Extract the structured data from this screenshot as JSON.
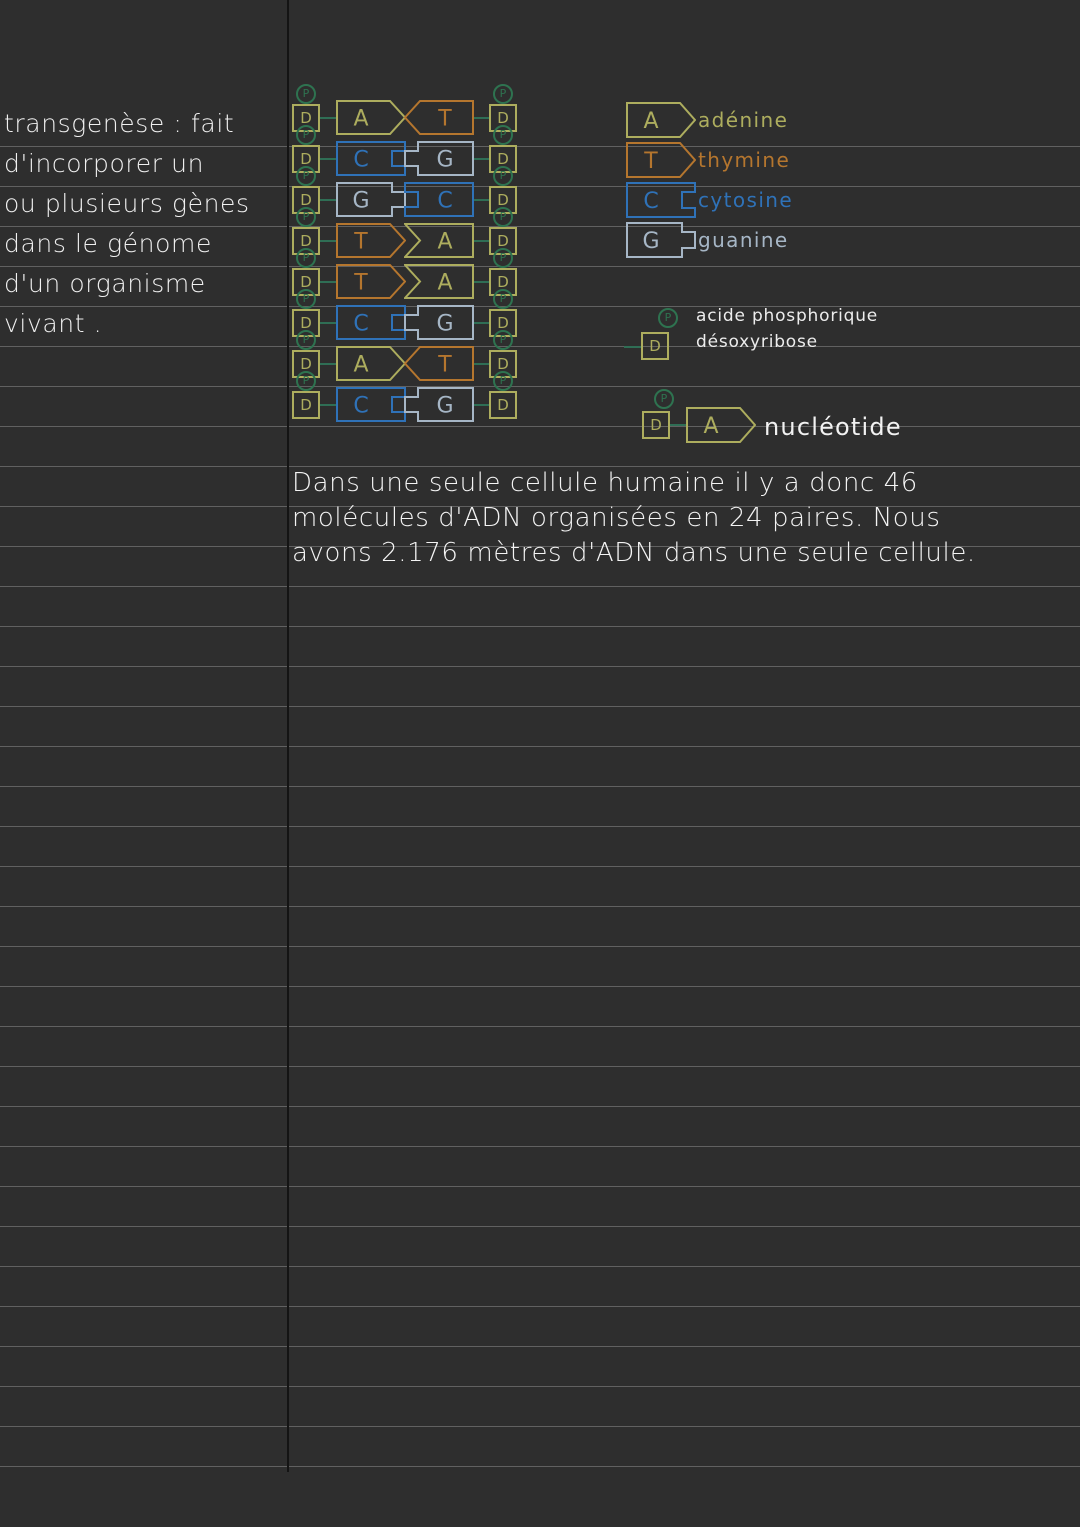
{
  "page": {
    "background_color": "#2e2e2e",
    "rule_color": "#a8a8a8",
    "margin_rule_color": "#141414"
  },
  "margin_note": {
    "text": "transgenèse : fait\nd'incorporer un\nou plusieurs gènes\ndans le génome\nd'un organisme\nvivant ."
  },
  "paragraph": {
    "text": "Dans une seule cellule humaine il y a donc 46\nmolécules d'ADN organisées en 24 paires. Nous\navons 2.176 mètres d'ADN dans une seule cellule."
  },
  "colors": {
    "adenine": "#adad5e",
    "thymine": "#b5762e",
    "cytosine": "#2f72b8",
    "guanine": "#a6b6c6",
    "phosphate": "#2e7350",
    "deoxyribose": "#adad5e",
    "link": "#2f6e55",
    "ink": "#f2f2f2"
  },
  "dna_ladder": {
    "phosphate_symbol": "P",
    "sugar_symbol": "D",
    "rows": [
      {
        "left_base": "A",
        "right_base": "T"
      },
      {
        "left_base": "C",
        "right_base": "G"
      },
      {
        "left_base": "G",
        "right_base": "C"
      },
      {
        "left_base": "T",
        "right_base": "A"
      },
      {
        "left_base": "T",
        "right_base": "A"
      },
      {
        "left_base": "C",
        "right_base": "G"
      },
      {
        "left_base": "A",
        "right_base": "T"
      },
      {
        "left_base": "C",
        "right_base": "G"
      }
    ]
  },
  "legend_bases": [
    {
      "symbol": "A",
      "label": "adénine",
      "color": "#adad5e"
    },
    {
      "symbol": "T",
      "label": "thymine",
      "color": "#b5762e"
    },
    {
      "symbol": "C",
      "label": "cytosine",
      "color": "#2f72b8"
    },
    {
      "symbol": "G",
      "label": "guanine",
      "color": "#a6b6c6"
    }
  ],
  "legend_parts": [
    {
      "symbol": "P",
      "label": "acide phosphorique"
    },
    {
      "symbol": "D",
      "label": "désoxyribose"
    }
  ],
  "legend_nucleotide": {
    "phosphate_symbol": "P",
    "sugar_symbol": "D",
    "base_symbol": "A",
    "label": "nucléotide"
  }
}
